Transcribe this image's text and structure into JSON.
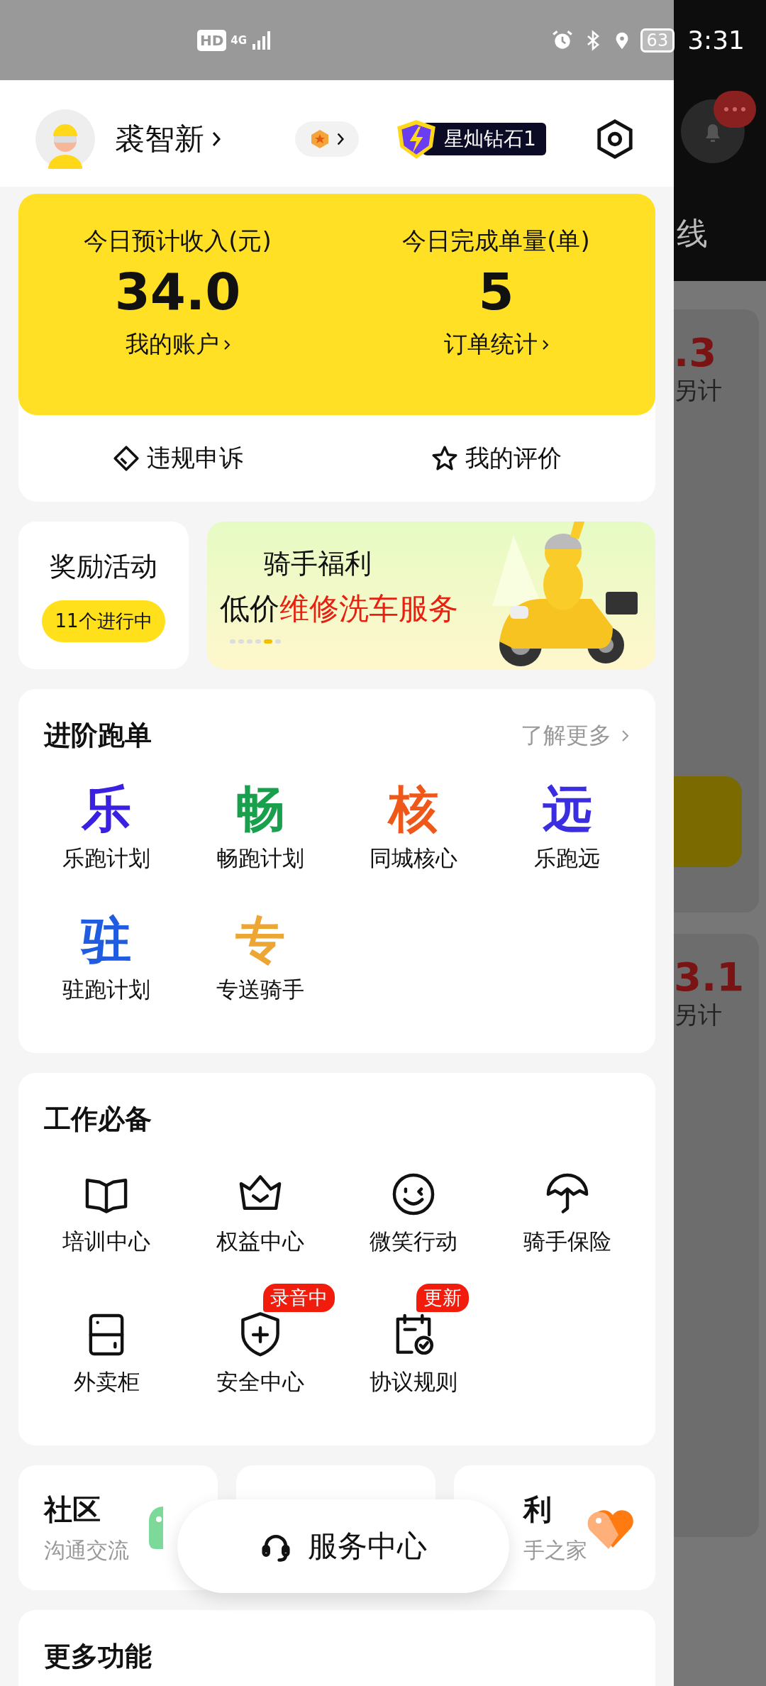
{
  "status_bar": {
    "hd": "HD",
    "network": "4G",
    "battery": "63",
    "time": "3:31"
  },
  "profile": {
    "name": "裘智新",
    "level_badge": "星灿钻石1"
  },
  "earnings": {
    "stats": [
      {
        "label": "今日预计收入(元)",
        "value": "34.0",
        "link": "我的账户"
      },
      {
        "label": "今日完成单量(单)",
        "value": "5",
        "link": "订单统计"
      }
    ],
    "actions": [
      {
        "kind": "appeal",
        "label": "违规申诉"
      },
      {
        "kind": "rating",
        "label": "我的评价"
      }
    ]
  },
  "rewards": {
    "title": "奖励活动",
    "badge": "11个进行中"
  },
  "banner": {
    "title": "骑手福利",
    "line_prefix": "低价",
    "line_highlight": "维修洗车服务",
    "dots": [
      {
        "selected": false
      },
      {
        "selected": false
      },
      {
        "selected": false
      },
      {
        "selected": false
      },
      {
        "selected": true
      },
      {
        "selected": false
      }
    ]
  },
  "advanced": {
    "title": "进阶跑单",
    "more": "了解更多",
    "items": [
      {
        "glyph": "乐",
        "label": "乐跑计划",
        "color": "#3a20e0"
      },
      {
        "glyph": "畅",
        "label": "畅跑计划",
        "color": "#18a04c"
      },
      {
        "glyph": "核",
        "label": "同城核心",
        "color": "#f0581a"
      },
      {
        "glyph": "远",
        "label": "乐跑远",
        "color": "#3b2ee0"
      },
      {
        "glyph": "驻",
        "label": "驻跑计划",
        "color": "#1f5ce0"
      },
      {
        "glyph": "专",
        "label": "专送骑手",
        "color": "#eda534"
      }
    ]
  },
  "essentials": {
    "title": "工作必备",
    "items": [
      {
        "kind": "book",
        "label": "培训中心"
      },
      {
        "kind": "crown",
        "label": "权益中心"
      },
      {
        "kind": "smile",
        "label": "微笑行动"
      },
      {
        "kind": "umbrella",
        "label": "骑手保险"
      },
      {
        "kind": "cabinet",
        "label": "外卖柜"
      },
      {
        "kind": "shield",
        "label": "安全中心",
        "badge": "录音中"
      },
      {
        "kind": "document",
        "label": "协议规则",
        "badge": "更新"
      }
    ]
  },
  "bottom_cards": [
    {
      "kind": "community",
      "title": "社区",
      "subtitle": "沟通交流"
    },
    {
      "kind": "hidden"
    },
    {
      "kind": "welfare",
      "title": "利",
      "subtitle": "手之家"
    }
  ],
  "service_button": "服务中心",
  "more_section": {
    "title": "更多功能"
  },
  "backdrop": {
    "header_text": "线",
    "cards": [
      {
        "amount": ".3",
        "note": "另计"
      },
      {
        "amount": "3.1",
        "note": "另计"
      }
    ]
  }
}
